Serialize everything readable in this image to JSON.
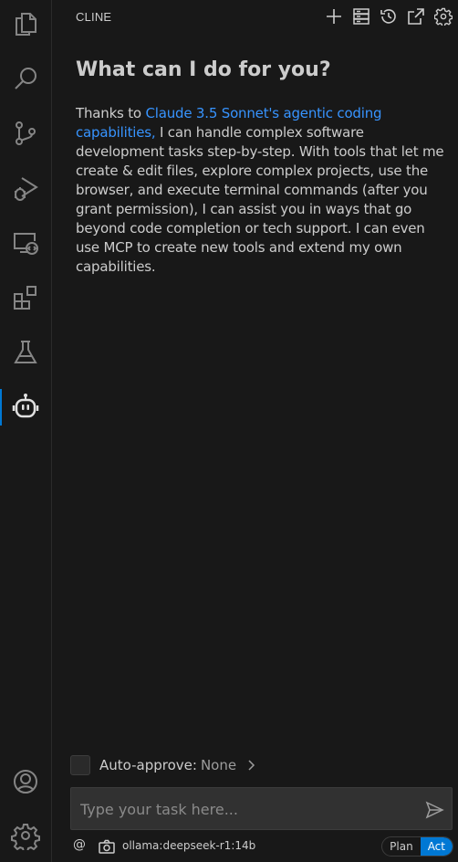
{
  "panel": {
    "title": "CLINE"
  },
  "header_actions": [
    {
      "name": "new-task",
      "icon": "plus-icon"
    },
    {
      "name": "mcp-servers",
      "icon": "server-icon"
    },
    {
      "name": "history",
      "icon": "history-icon"
    },
    {
      "name": "open-in-editor",
      "icon": "external-link-icon"
    },
    {
      "name": "settings",
      "icon": "gear-icon"
    }
  ],
  "activity_bar": [
    {
      "name": "explorer",
      "icon": "files-icon"
    },
    {
      "name": "search",
      "icon": "search-icon"
    },
    {
      "name": "source-control",
      "icon": "git-branch-icon"
    },
    {
      "name": "run-debug",
      "icon": "run-debug-icon"
    },
    {
      "name": "remote-explorer",
      "icon": "remote-icon"
    },
    {
      "name": "extensions",
      "icon": "extensions-icon"
    },
    {
      "name": "testing",
      "icon": "beaker-icon"
    },
    {
      "name": "cline",
      "icon": "robot-icon",
      "active": true
    },
    {
      "name": "accounts",
      "icon": "account-icon"
    },
    {
      "name": "manage",
      "icon": "gear-icon"
    }
  ],
  "welcome": {
    "heading": "What can I do for you?",
    "intro": "Thanks to ",
    "link_text": "Claude 3.5 Sonnet's agentic coding capabilities,",
    "body": " I can handle complex software development tasks step-by-step. With tools that let me create & edit files, explore complex projects, use the browser, and execute terminal commands (after you grant permission), I can assist you in ways that go beyond code completion or tech support. I can even use MCP to create new tools and extend my own capabilities."
  },
  "auto_approve": {
    "label": "Auto-approve:",
    "value": "None"
  },
  "task_input": {
    "placeholder": "Type your task here...",
    "value": ""
  },
  "bottom_bar": {
    "at_label": "@",
    "model": "ollama:deepseek-r1:14b",
    "modes": [
      "Plan",
      "Act"
    ],
    "selected_mode": "Act"
  },
  "colors": {
    "accent": "#0078d4",
    "link": "#3794ff",
    "background": "#181818"
  }
}
